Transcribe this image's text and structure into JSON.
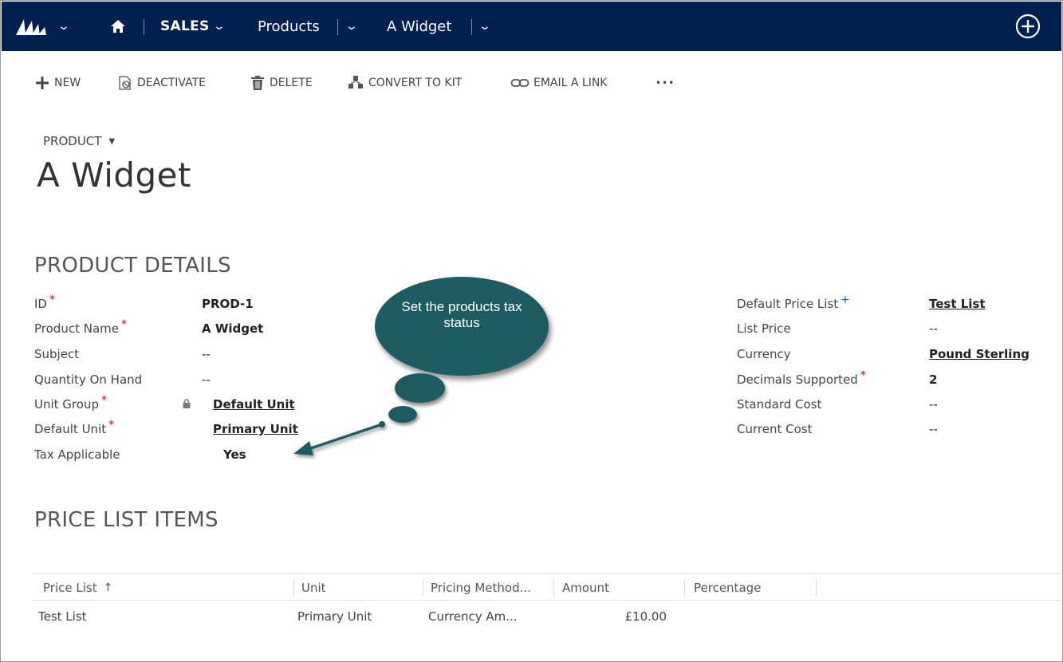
{
  "nav": {
    "area": "SALES",
    "entity": "Products",
    "record": "A Widget"
  },
  "commands": {
    "new": "NEW",
    "deactivate": "DEACTIVATE",
    "delete": "DELETE",
    "convert_to_kit": "CONVERT TO KIT",
    "email_link": "EMAIL A LINK",
    "more": "•••"
  },
  "header": {
    "entity_label": "PRODUCT",
    "title": "A Widget"
  },
  "product_details": {
    "title": "PRODUCT DETAILS",
    "left": [
      {
        "label": "ID",
        "required": true,
        "value": "PROD-1",
        "style": "bold"
      },
      {
        "label": "Product Name",
        "required": true,
        "value": "A Widget",
        "style": "bold"
      },
      {
        "label": "Subject",
        "required": false,
        "value": "--",
        "style": "plain"
      },
      {
        "label": "Quantity On Hand",
        "required": false,
        "value": "--",
        "style": "plain"
      },
      {
        "label": "Unit Group",
        "required": true,
        "value": "Default Unit",
        "style": "link",
        "locked": true
      },
      {
        "label": "Default Unit",
        "required": true,
        "value": "Primary Unit",
        "style": "link"
      },
      {
        "label": "Tax Applicable",
        "required": false,
        "value": "Yes",
        "style": "bold"
      }
    ],
    "right": [
      {
        "label": "Default Price List",
        "recommended": true,
        "value": "Test List",
        "style": "link"
      },
      {
        "label": "List Price",
        "value": "--",
        "style": "plain"
      },
      {
        "label": "Currency",
        "value": "Pound Sterling",
        "style": "link"
      },
      {
        "label": "Decimals Supported",
        "required": true,
        "value": "2",
        "style": "bold"
      },
      {
        "label": "Standard Cost",
        "value": "--",
        "style": "plain"
      },
      {
        "label": "Current Cost",
        "value": "--",
        "style": "plain"
      }
    ]
  },
  "callout": {
    "text": "Set the products tax status"
  },
  "price_list_items": {
    "title": "PRICE LIST ITEMS",
    "columns": [
      "Price List",
      "Unit",
      "Pricing Method...",
      "Amount",
      "Percentage"
    ],
    "sort_indicator": "↑",
    "rows": [
      {
        "price_list": "Test List",
        "unit": "Primary Unit",
        "pricing_method": "Currency Am...",
        "amount": "£10.00",
        "percentage": ""
      }
    ]
  },
  "colors": {
    "navbar": "#002050",
    "callout": "#1d5c63",
    "required": "#e00000",
    "recommended": "#2266cc"
  }
}
